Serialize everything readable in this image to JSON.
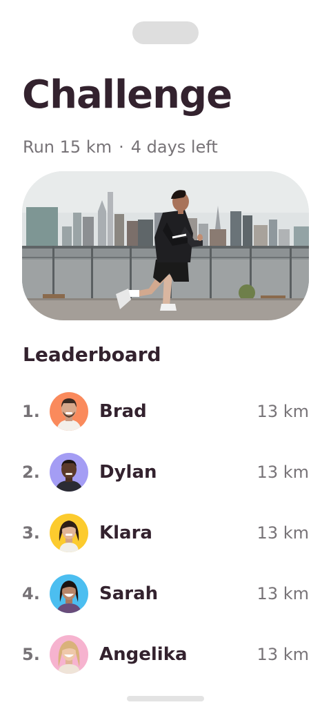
{
  "challenge": {
    "title": "Challenge",
    "goal": "Run 15 km",
    "separator": "·",
    "time_left": "4 days left"
  },
  "hero": {
    "image": "man-running-city-waterfront-photo"
  },
  "leaderboard": {
    "title": "Leaderboard",
    "entries": [
      {
        "rank": "1.",
        "name": "Brad",
        "distance": "13 km",
        "avatar_color": "#fa8a5c"
      },
      {
        "rank": "2.",
        "name": "Dylan",
        "distance": "13 km",
        "avatar_color": "#a49df4"
      },
      {
        "rank": "3.",
        "name": "Klara",
        "distance": "13 km",
        "avatar_color": "#fccb2e"
      },
      {
        "rank": "4.",
        "name": "Sarah",
        "distance": "13 km",
        "avatar_color": "#4cbef0"
      },
      {
        "rank": "5.",
        "name": "Angelika",
        "distance": "13 km",
        "avatar_color": "#f6b3cf"
      }
    ]
  },
  "colors": {
    "title": "#33222e",
    "muted": "#777377"
  }
}
